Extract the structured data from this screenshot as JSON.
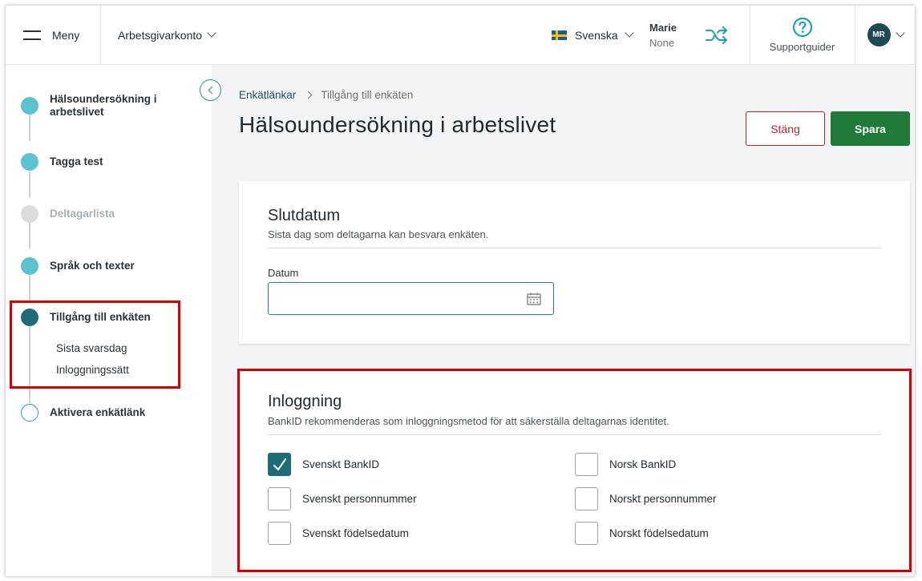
{
  "header": {
    "menu_label": "Meny",
    "account_label": "Arbetsgivarkonto",
    "language": "Svenska",
    "user_name": "Marie",
    "user_sub": "None",
    "support_label": "Supportguider",
    "avatar_initials": "MR"
  },
  "sidebar": {
    "steps": [
      {
        "label": "Hälsoundersökning i arbetslivet",
        "state": "done"
      },
      {
        "label": "Tagga test",
        "state": "done"
      },
      {
        "label": "Deltagarlista",
        "state": "disabled"
      },
      {
        "label": "Språk och texter",
        "state": "done"
      },
      {
        "label": "Tillgång till enkäten",
        "state": "current"
      },
      {
        "label": "Aktivera enkätlänk",
        "state": "todo"
      }
    ],
    "substeps": [
      "Sista svarsdag",
      "Inloggningssätt"
    ]
  },
  "breadcrumb": {
    "parent": "Enkätlänkar",
    "current": "Tillgång till enkäten"
  },
  "page_title": "Hälsoundersökning i arbetslivet",
  "actions": {
    "close_label": "Stäng",
    "save_label": "Spara"
  },
  "enddate": {
    "title": "Slutdatum",
    "description": "Sista dag som deltagarna kan besvara enkäten.",
    "field_label": "Datum",
    "value": ""
  },
  "login": {
    "title": "Inloggning",
    "description": "BankID rekommenderas som inloggningsmetod för att säkerställa deltagarnas identitet.",
    "options": [
      {
        "label": "Svenskt BankID",
        "checked": true
      },
      {
        "label": "Norsk BankID",
        "checked": false
      },
      {
        "label": "Svenskt personnummer",
        "checked": false
      },
      {
        "label": "Norskt personnummer",
        "checked": false
      },
      {
        "label": "Svenskt födelsedatum",
        "checked": false
      },
      {
        "label": "Norskt födelsedatum",
        "checked": false
      }
    ]
  },
  "colors": {
    "accent": "#1d6c78",
    "done_step": "#5bc2d0",
    "disabled_step": "#d9dde0",
    "primary_button": "#207a37",
    "danger_button": "#b3262c",
    "highlight": "#d40000"
  }
}
